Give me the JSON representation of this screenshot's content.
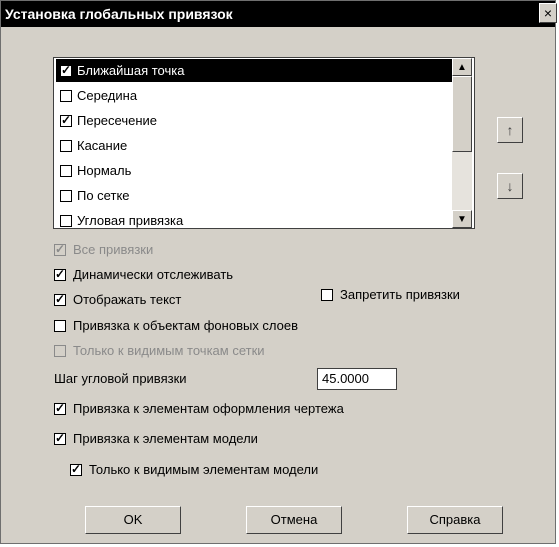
{
  "window": {
    "title": "Установка глобальных привязок",
    "close_label": "×"
  },
  "snap_list": {
    "items": [
      {
        "label": "Ближайшая точка",
        "checked": true,
        "selected": true
      },
      {
        "label": "Середина",
        "checked": false
      },
      {
        "label": "Пересечение",
        "checked": true
      },
      {
        "label": "Касание",
        "checked": false
      },
      {
        "label": "Нормаль",
        "checked": false
      },
      {
        "label": "По сетке",
        "checked": false
      },
      {
        "label": "Угловая привязка",
        "checked": false
      }
    ],
    "move_up_icon": "↑",
    "move_down_icon": "↓"
  },
  "options": {
    "all_snaps": {
      "label": "Все привязки",
      "checked": true,
      "disabled": true
    },
    "dynamic_tracking": {
      "label": "Динамически отслеживать",
      "checked": true
    },
    "show_text": {
      "label": "Отображать текст",
      "checked": true
    },
    "forbid_snaps": {
      "label": "Запретить привязки",
      "checked": false
    },
    "background_layers": {
      "label": "Привязка к объектам фоновых слоев",
      "checked": false
    },
    "visible_grid_points": {
      "label": "Только к видимым точкам сетки",
      "checked": false,
      "disabled": true
    },
    "angle_step_label": "Шаг угловой привязки",
    "angle_step_value": "45.0000",
    "drawing_elements": {
      "label": "Привязка к элементам оформления чертежа",
      "checked": true
    },
    "model_elements": {
      "label": "Привязка к элементам модели",
      "checked": true
    },
    "visible_model_elements": {
      "label": "Только к видимым элементам модели",
      "checked": true
    }
  },
  "buttons": {
    "ok": "OK",
    "cancel": "Отмена",
    "help": "Справка"
  }
}
